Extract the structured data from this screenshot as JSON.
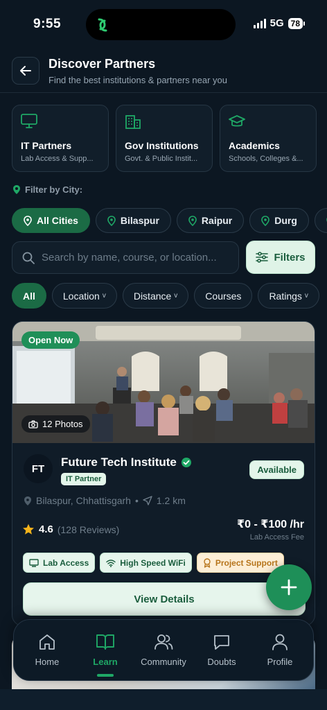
{
  "status_bar": {
    "time": "9:55",
    "network": "5G",
    "battery": "78"
  },
  "header": {
    "title": "Discover Partners",
    "subtitle": "Find the best institutions & partners near you"
  },
  "categories": [
    {
      "title": "IT Partners",
      "subtitle": "Lab Access & Supp...",
      "icon": "monitor-icon"
    },
    {
      "title": "Gov Institutions",
      "subtitle": "Govt. & Public Instit...",
      "icon": "building-icon"
    },
    {
      "title": "Academics",
      "subtitle": "Schools, Colleges &...",
      "icon": "graduation-cap-icon"
    }
  ],
  "city_filter": {
    "label": "Filter by City:",
    "cities": [
      "All Cities",
      "Bilaspur",
      "Raipur",
      "Durg"
    ],
    "selected": "All Cities"
  },
  "search": {
    "placeholder": "Search by name, course, or location..."
  },
  "filters_button": "Filters",
  "sort_chips": [
    {
      "label": "All",
      "active": true
    },
    {
      "label": "Location",
      "caret": "v"
    },
    {
      "label": "Distance",
      "caret": "v"
    },
    {
      "label": "Courses"
    },
    {
      "label": "Ratings",
      "caret": "v"
    }
  ],
  "card": {
    "open_badge": "Open Now",
    "photos": "12 Photos",
    "logo": "FT",
    "name": "Future Tech Institute",
    "type": "IT Partner",
    "availability": "Available",
    "location": "Bilaspur, Chhattisgarh",
    "separator": "•",
    "distance": "1.2 km",
    "rating": "4.6",
    "reviews": "(128 Reviews)",
    "price": "₹0 - ₹100 /hr",
    "price_label": "Lab Access Fee",
    "features": [
      "Lab Access",
      "High Speed WiFi",
      "Project Support"
    ],
    "cta": "View Details"
  },
  "bottom_nav": [
    {
      "label": "Home",
      "icon": "home-icon"
    },
    {
      "label": "Learn",
      "icon": "book-icon",
      "active": true
    },
    {
      "label": "Community",
      "icon": "users-icon"
    },
    {
      "label": "Doubts",
      "icon": "chat-icon"
    },
    {
      "label": "Profile",
      "icon": "user-icon"
    }
  ],
  "colors": {
    "accent": "#1b6b45",
    "accent_bright": "#1fa866",
    "background": "#0c1722",
    "warning": "#b7751c"
  }
}
